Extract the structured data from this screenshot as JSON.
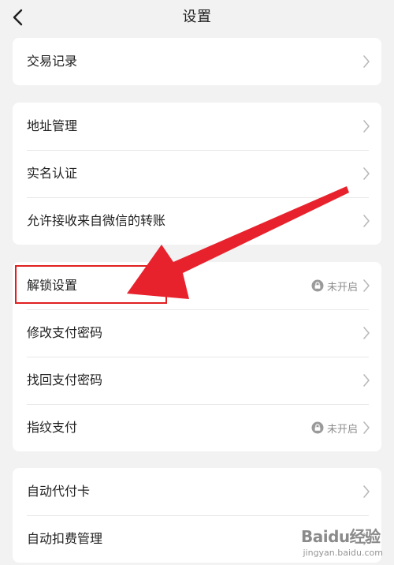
{
  "header": {
    "title": "设置"
  },
  "groups": [
    {
      "items": [
        {
          "label": "交易记录"
        }
      ]
    },
    {
      "items": [
        {
          "label": "地址管理"
        },
        {
          "label": "实名认证"
        },
        {
          "label": "允许接收来自微信的转账"
        }
      ]
    },
    {
      "items": [
        {
          "label": "解锁设置",
          "status": "未开启"
        },
        {
          "label": "修改支付密码"
        },
        {
          "label": "找回支付密码"
        },
        {
          "label": "指纹支付",
          "status": "未开启"
        }
      ]
    },
    {
      "items": [
        {
          "label": "自动代付卡"
        },
        {
          "label": "自动扣费管理"
        }
      ]
    }
  ],
  "watermark": {
    "brand": "Baidu经验",
    "url": "jingyan.baidu.com"
  },
  "colors": {
    "annotation": "#e02020",
    "background": "#f2f2f2",
    "card": "#ffffff",
    "status_text": "#8e8e8e"
  },
  "icons": {
    "back": "chevron-left-icon",
    "row_arrow": "chevron-right-icon",
    "status": "lock-icon"
  }
}
